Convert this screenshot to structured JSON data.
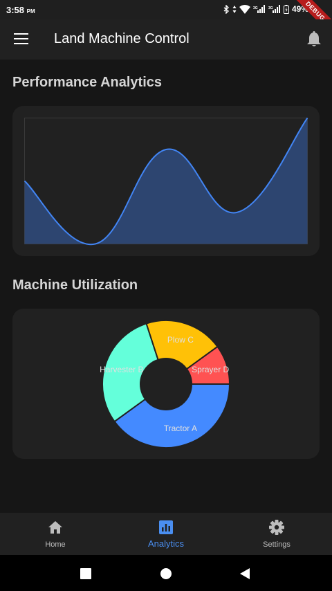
{
  "status_bar": {
    "time": "3:58",
    "ampm": "PM",
    "battery": "49%",
    "debug_label": "DEBUG"
  },
  "appbar": {
    "title": "Land Machine Control"
  },
  "performance": {
    "title": "Performance Analytics"
  },
  "utilization": {
    "title": "Machine Utilization"
  },
  "chart_data": [
    {
      "type": "area",
      "x": [
        0,
        1,
        2,
        3,
        4
      ],
      "values": [
        5,
        0,
        7.5,
        2.5,
        10
      ],
      "ylim": [
        0,
        10
      ],
      "colors": {
        "line": "#4285f4",
        "fill": "#2d4570"
      }
    },
    {
      "type": "pie",
      "donut": true,
      "start_angle": "right, clockwise",
      "labels": [
        "Tractor A",
        "Harvester B",
        "Plow C",
        "Sprayer D"
      ],
      "values": [
        40,
        30,
        20,
        10
      ],
      "colors": [
        "#448aff",
        "#64ffda",
        "#ffc107",
        "#ff5252"
      ]
    }
  ],
  "bottom_nav": {
    "items": [
      {
        "label": "Home",
        "icon": "home-icon"
      },
      {
        "label": "Analytics",
        "icon": "analytics-icon"
      },
      {
        "label": "Settings",
        "icon": "gear-icon"
      }
    ],
    "active_index": 1,
    "accent": "#4a8ef0"
  }
}
